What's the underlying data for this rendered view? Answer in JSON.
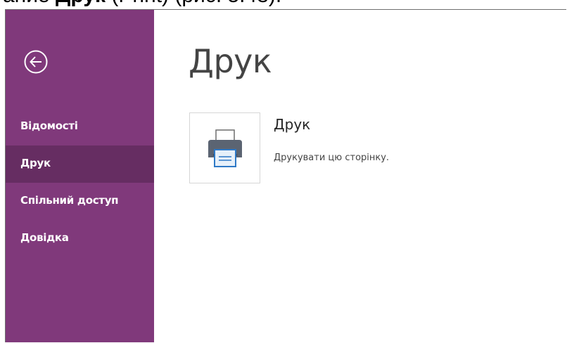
{
  "caption": {
    "prefix": "ание ",
    "bold": "Друк",
    "suffix": " (Print) (рис. 5.48)."
  },
  "backstage": {
    "back_icon": "back-arrow-circle-icon",
    "accent_color": "#80397b",
    "active_color": "#662d62",
    "nav_items": [
      {
        "label": "Відомості"
      },
      {
        "label": "Друк"
      },
      {
        "label": "Спільний доступ"
      },
      {
        "label": "Довідка"
      }
    ]
  },
  "main": {
    "page_title": "Друк",
    "print_option": {
      "icon": "printer-icon",
      "title": "Друк",
      "description": "Друкувати цю сторінку."
    }
  }
}
